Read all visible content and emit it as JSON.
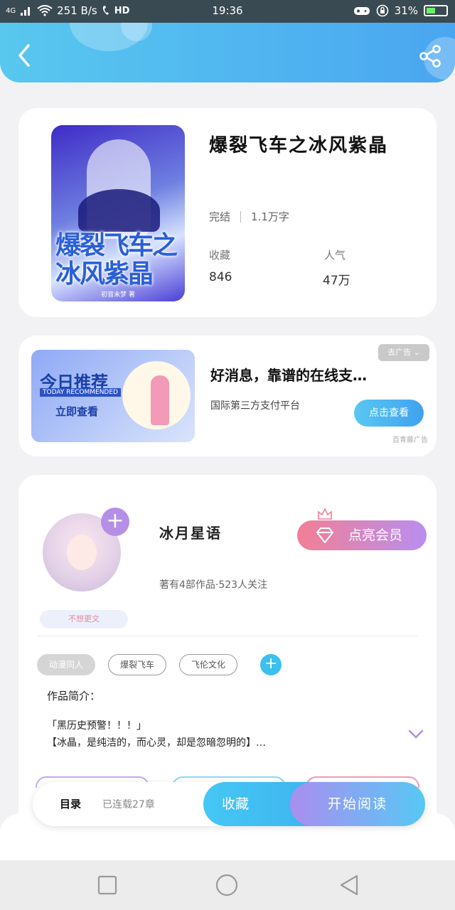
{
  "status_bar": {
    "network": "4G",
    "speed": "251 B/s",
    "hd": "HD",
    "time": "19:36",
    "battery": "31%"
  },
  "header": {
    "back_icon": "chevron-left-icon",
    "share_icon": "share-icon",
    "accent_start": "#58c8ef",
    "accent_end": "#4aa6f0"
  },
  "book": {
    "cover_title": "爆裂飞车之冰风紫晶",
    "cover_author": "初音未梦 著",
    "title": "爆裂飞车之冰风紫晶",
    "status": "完结",
    "word_count": "1.1万字",
    "favorites_label": "收藏",
    "favorites_value": "846",
    "popularity_label": "人气",
    "popularity_value": "47万"
  },
  "ad": {
    "image_title": "今日推荐",
    "image_subtitle": "TODAY RECOMMENDED",
    "image_cta": "立即查看",
    "tag": "去广告",
    "title": "好消息，靠谱的在线支…",
    "subtitle": "国际第三方支付平台",
    "button": "点击查看",
    "source": "百青藤广告"
  },
  "author": {
    "name": "冰月星语",
    "stats": "著有4部作品·523人关注",
    "badge": "不想更文",
    "vip_button": "点亮会员",
    "follow_icon": "plus-icon"
  },
  "tags": [
    "动漫同人",
    "爆裂飞车",
    "飞伦文化"
  ],
  "intro": {
    "label": "作品简介：",
    "line1": "「黑历史预警！！！」",
    "line2": "【冰晶，是纯洁的，而心灵，却是忽暗忽明的】…"
  },
  "bottom_bar": {
    "toc_label": "目录",
    "chapters": "已连载27章",
    "favorite_button": "收藏",
    "read_button": "开始阅读"
  },
  "nav": {
    "recents_icon": "square-icon",
    "home_icon": "circle-icon",
    "back_icon": "triangle-back-icon"
  }
}
